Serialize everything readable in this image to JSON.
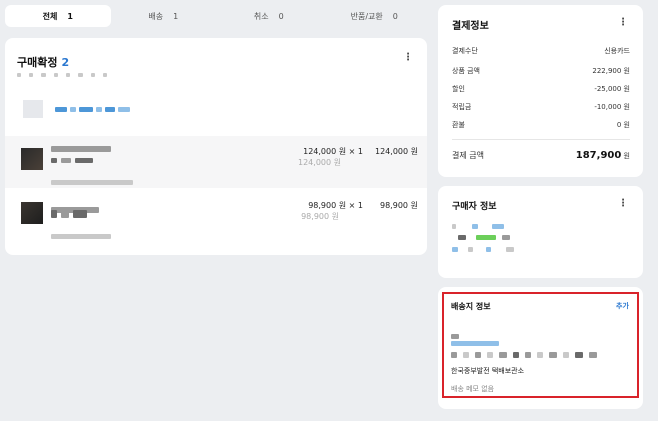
{
  "tabs": [
    {
      "label": "전체",
      "count": "1"
    },
    {
      "label": "배송",
      "count": "1"
    },
    {
      "label": "취소",
      "count": "0"
    },
    {
      "label": "반품/교환",
      "count": "0"
    }
  ],
  "order": {
    "title": "구매확정",
    "count": "2",
    "items": [
      {
        "price": "124,000 원",
        "times": "× 1",
        "original_price": "124,000 원",
        "total": "124,000 원"
      },
      {
        "price": "98,900 원",
        "times": "× 1",
        "original_price": "98,900 원",
        "total": "98,900 원"
      }
    ]
  },
  "payment": {
    "title": "결제정보",
    "rows": [
      {
        "label": "결제수단",
        "value": "신용카드"
      },
      {
        "label": "상품 금액",
        "value": "222,900 원"
      },
      {
        "label": "할인",
        "value": "-25,000 원"
      },
      {
        "label": "적립금",
        "value": "-10,000 원"
      },
      {
        "label": "환불",
        "value": "0 원"
      }
    ],
    "total_label": "결제 금액",
    "total_value": "187,900",
    "total_unit": "원"
  },
  "buyer": {
    "title": "구매자 정보"
  },
  "shipping": {
    "title": "배송지 정보",
    "add_label": "추가",
    "address_name": "한국중부발전 택배보관소",
    "memo": "배송 메모 없음"
  },
  "icons": {
    "more": "kebab-menu-icon"
  },
  "colors": {
    "accent": "#2b78d0",
    "highlight_border": "#d9232a"
  }
}
